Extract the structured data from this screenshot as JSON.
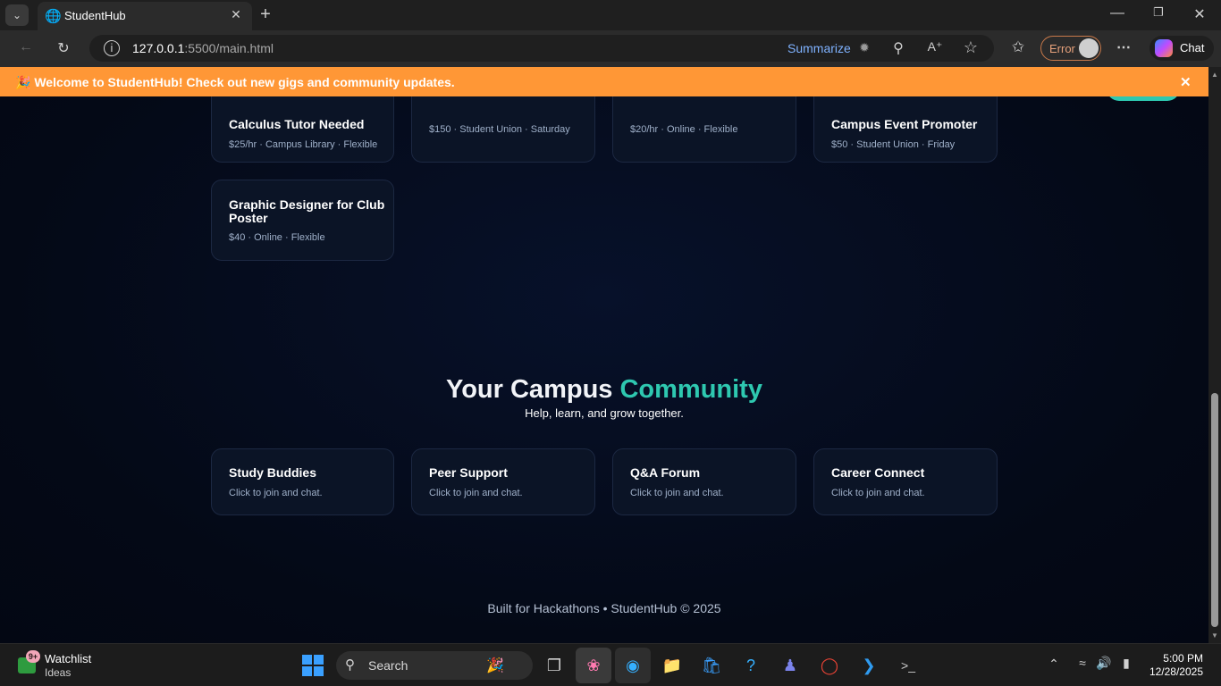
{
  "browser": {
    "tab_title": "StudentHub",
    "url_host": "127.0.0.1",
    "url_path": ":5500/main.html",
    "summarize_label": "Summarize",
    "error_label": "Error",
    "chat_label": "Chat"
  },
  "banner": {
    "text": "🎉 Welcome to StudentHub! Check out new gigs and community updates.",
    "close": "✕"
  },
  "gigs": [
    {
      "title": "Calculus Tutor Needed",
      "meta": "$25/hr · Campus Library · Flexible"
    },
    {
      "title": "",
      "meta": "$150 · Student Union · Saturday"
    },
    {
      "title": "",
      "meta": "$20/hr · Online · Flexible"
    },
    {
      "title": "Campus Event Promoter",
      "meta": "$50 · Student Union · Friday"
    },
    {
      "title": "Graphic Designer for Club Poster",
      "meta": "$40 · Online · Flexible"
    }
  ],
  "community": {
    "title_main": "Your Campus ",
    "title_accent": "Community",
    "subtitle": "Help, learn, and grow together.",
    "cards": [
      {
        "title": "Study Buddies",
        "meta": "Click to join and chat."
      },
      {
        "title": "Peer Support",
        "meta": "Click to join and chat."
      },
      {
        "title": "Q&A Forum",
        "meta": "Click to join and chat."
      },
      {
        "title": "Career Connect",
        "meta": "Click to join and chat."
      }
    ]
  },
  "footer": "Built for Hackathons • StudentHub © 2025",
  "taskbar": {
    "widget_title": "Watchlist",
    "widget_sub": "Ideas",
    "widget_badge": "9+",
    "search_label": "Search",
    "time": "5:00 PM",
    "date": "12/28/2025"
  },
  "colors": {
    "banner": "#ff9736",
    "accent": "#2ec8b0",
    "background": "#050b1a"
  }
}
